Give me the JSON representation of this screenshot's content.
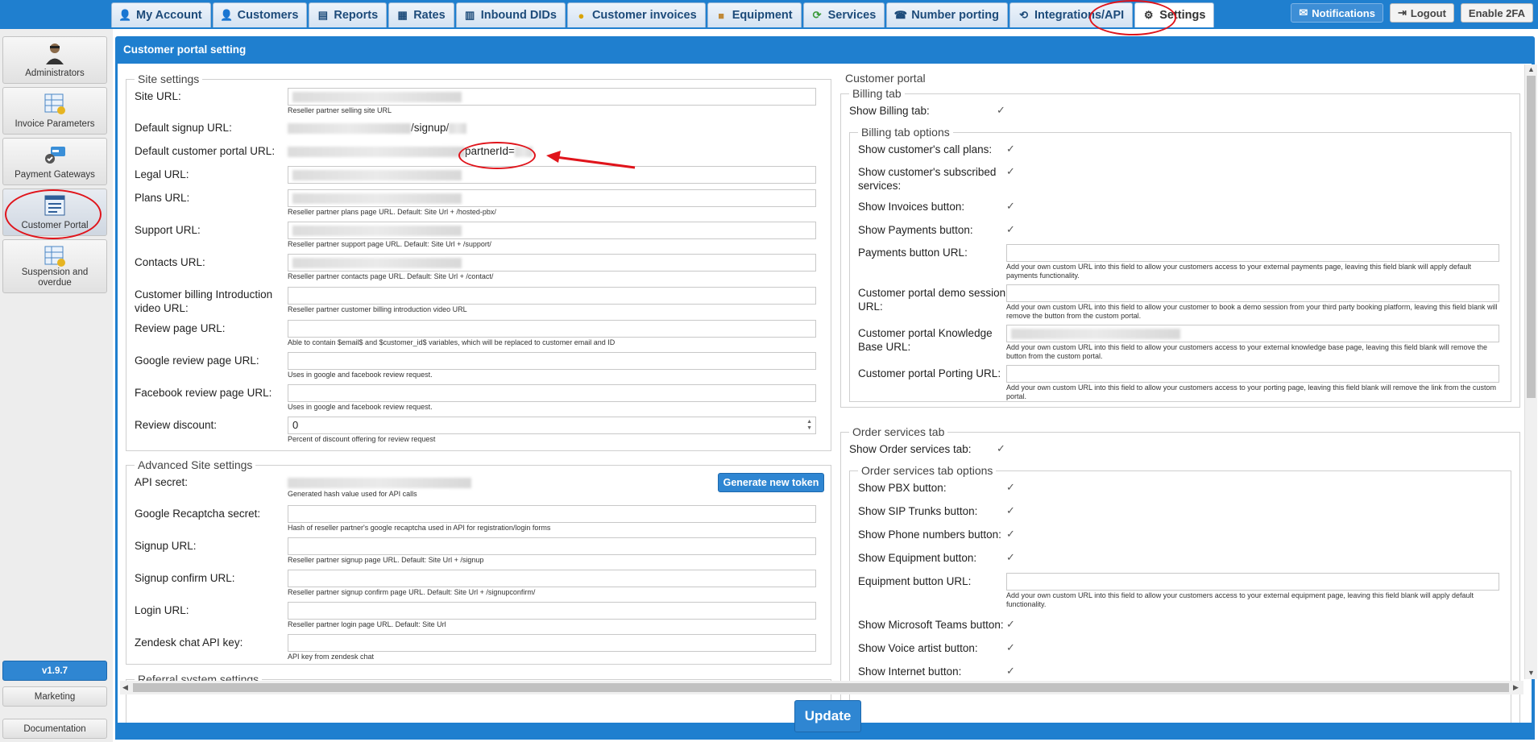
{
  "nav": {
    "tabs": [
      {
        "label": "My Account",
        "icon": "user-icon"
      },
      {
        "label": "Customers",
        "icon": "customers-icon"
      },
      {
        "label": "Reports",
        "icon": "reports-icon"
      },
      {
        "label": "Rates",
        "icon": "rates-icon"
      },
      {
        "label": "Inbound DIDs",
        "icon": "inbound-dids-icon"
      },
      {
        "label": "Customer invoices",
        "icon": "coins-icon"
      },
      {
        "label": "Equipment",
        "icon": "box-icon"
      },
      {
        "label": "Services",
        "icon": "services-icon"
      },
      {
        "label": "Number porting",
        "icon": "phone-icon"
      },
      {
        "label": "Integrations/API",
        "icon": "integrations-icon"
      },
      {
        "label": "Settings",
        "icon": "gears-icon"
      }
    ],
    "active_tab": "Settings",
    "notifications": "Notifications",
    "logout": "Logout",
    "enable_2fa": "Enable 2FA"
  },
  "sidebar": {
    "items": [
      {
        "label": "Administrators",
        "icon": "administrator-icon"
      },
      {
        "label": "Invoice Parameters",
        "icon": "invoice-table-icon"
      },
      {
        "label": "Payment Gateways",
        "icon": "payment-card-icon"
      },
      {
        "label": "Customer Portal",
        "icon": "customer-portal-icon"
      },
      {
        "label": "Suspension and overdue",
        "icon": "suspension-icon"
      }
    ],
    "active": "Customer Portal",
    "version": "v1.9.7",
    "marketing": "Marketing",
    "documentation": "Documentation"
  },
  "page": {
    "title": "Customer portal setting",
    "update": "Update"
  },
  "site_settings": {
    "legend": "Site settings",
    "site_url": {
      "label": "Site URL:",
      "hint": "Reseller partner selling site URL"
    },
    "default_signup_url": {
      "label": "Default signup URL:",
      "suffix": "/signup/"
    },
    "default_portal_url": {
      "label": "Default customer portal URL:",
      "suffix": "partnerId="
    },
    "legal_url": {
      "label": "Legal URL:"
    },
    "plans_url": {
      "label": "Plans URL:",
      "hint": "Reseller partner plans page URL. Default: Site Url + /hosted-pbx/"
    },
    "support_url": {
      "label": "Support URL:",
      "hint": "Reseller partner support page URL. Default: Site Url + /support/"
    },
    "contacts_url": {
      "label": "Contacts URL:",
      "hint": "Reseller partner contacts page URL. Default: Site Url + /contact/"
    },
    "billing_video_url": {
      "label_1": "Customer billing Introduction",
      "label_2": "video URL:",
      "hint": "Reseller partner customer billing introduction video URL"
    },
    "review_page_url": {
      "label": "Review page URL:",
      "hint": "Able to contain $email$ and $customer_id$ variables, which will be replaced to customer email and ID"
    },
    "google_review_url": {
      "label": "Google review page URL:",
      "hint": "Uses in google and facebook review request."
    },
    "facebook_review_url": {
      "label": "Facebook review page URL:",
      "hint": "Uses in google and facebook review request."
    },
    "review_discount": {
      "label": "Review discount:",
      "value": "0",
      "hint": "Percent of discount offering for review request"
    }
  },
  "advanced_settings": {
    "legend": "Advanced Site settings",
    "api_secret": {
      "label": "API secret:",
      "hint": "Generated hash value used for API calls",
      "button": "Generate new token"
    },
    "recaptcha_secret": {
      "label": "Google Recaptcha secret:",
      "hint": "Hash of reseller partner's google recaptcha used in API for registration/login forms"
    },
    "signup_url": {
      "label": "Signup URL:",
      "hint": "Reseller partner signup page URL. Default: Site Url + /signup"
    },
    "signup_confirm_url": {
      "label": "Signup confirm URL:",
      "hint": "Reseller partner signup confirm page URL. Default: Site Url + /signupconfirm/"
    },
    "login_url": {
      "label": "Login URL:",
      "hint": "Reseller partner login page URL. Default: Site Url"
    },
    "zendesk_key": {
      "label": "Zendesk chat API key:",
      "hint": "API key from zendesk chat"
    }
  },
  "referral": {
    "legend": "Referral system settings"
  },
  "customer_portal": {
    "legend": "Customer portal",
    "billing_tab": {
      "legend": "Billing tab",
      "show_billing_tab": {
        "label": "Show Billing tab:",
        "checked": true
      },
      "options_legend": "Billing tab options",
      "call_plans": {
        "label": "Show customer's call plans:",
        "checked": true
      },
      "subscribed_services": {
        "label_1": "Show customer's subscribed",
        "label_2": "services:",
        "checked": true
      },
      "invoices_button": {
        "label": "Show Invoices button:",
        "checked": true
      },
      "payments_button": {
        "label": "Show Payments button:",
        "checked": true
      },
      "payments_button_url": {
        "label": "Payments button URL:",
        "hint": "Add your own custom URL into this field to allow your customers access to your external payments page, leaving this field blank will apply default payments functionality."
      },
      "demo_session_url": {
        "label_1": "Customer portal demo session",
        "label_2": "URL:",
        "hint": "Add your own custom URL into this field to allow your customer to book a demo session from your third party booking platform, leaving this field blank will remove the button from the custom portal."
      },
      "knowledge_base_url": {
        "label_1": "Customer portal Knowledge",
        "label_2": "Base URL:",
        "hint": "Add your own custom URL into this field to allow your customers access to your external knowledge base page, leaving this field blank will remove the button from the custom portal."
      },
      "porting_url": {
        "label": "Customer portal Porting URL:",
        "hint": "Add your own custom URL into this field to allow your customers access to your porting page, leaving this field blank will remove the link from the custom portal."
      }
    },
    "order_tab": {
      "legend": "Order services tab",
      "show_order_tab": {
        "label": "Show Order services tab:",
        "checked": true
      },
      "options_legend": "Order services tab options",
      "pbx_button": {
        "label": "Show PBX button:",
        "checked": true
      },
      "sip_trunks_button": {
        "label": "Show SIP Trunks button:",
        "checked": true
      },
      "phone_numbers_button": {
        "label": "Show Phone numbers button:",
        "checked": true
      },
      "equipment_button": {
        "label": "Show Equipment button:",
        "checked": true
      },
      "equipment_button_url": {
        "label": "Equipment button URL:",
        "hint": "Add your own custom URL into this field to allow your customers access to your external equipment page, leaving this field blank will apply default functionality."
      },
      "ms_teams_button": {
        "label": "Show Microsoft Teams button:",
        "checked": true
      },
      "voice_artist_button": {
        "label": "Show Voice artist button:",
        "checked": true
      },
      "internet_button": {
        "label": "Show Internet button:",
        "checked": true
      }
    }
  },
  "colors": {
    "brand_blue": "#1f7fcf",
    "highlight_red": "#e0141b"
  }
}
